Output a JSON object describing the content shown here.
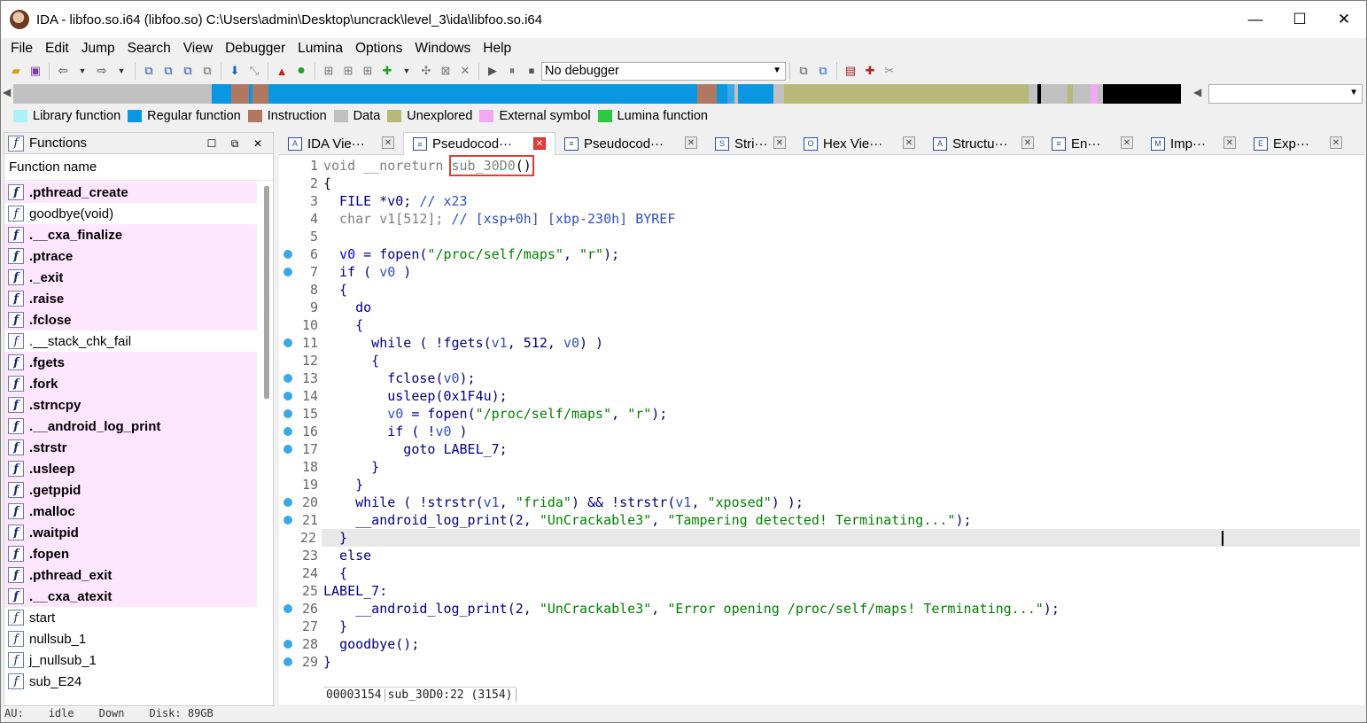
{
  "window": {
    "title": "IDA - libfoo.so.i64 (libfoo.so) C:\\Users\\admin\\Desktop\\uncrack\\level_3\\ida\\libfoo.so.i64",
    "minimize": "—",
    "maximize": "☐",
    "close": "✕"
  },
  "menu": [
    "File",
    "Edit",
    "Jump",
    "Search",
    "View",
    "Debugger",
    "Lumina",
    "Options",
    "Windows",
    "Help"
  ],
  "toolbar": {
    "debugger_value": "No debugger"
  },
  "legend": [
    {
      "label": "Library function",
      "color": "#aaf2f8"
    },
    {
      "label": "Regular function",
      "color": "#0a96e0"
    },
    {
      "label": "Instruction",
      "color": "#b07860"
    },
    {
      "label": "Data",
      "color": "#c0c0c0"
    },
    {
      "label": "Unexplored",
      "color": "#b8b878"
    },
    {
      "label": "External symbol",
      "color": "#f4a8f4"
    },
    {
      "label": "Lumina function",
      "color": "#30c840"
    }
  ],
  "functions_panel": {
    "title": "Functions",
    "column": "Function name",
    "items": [
      {
        "name": ".pthread_create",
        "lib": true
      },
      {
        "name": "goodbye(void)",
        "lib": false
      },
      {
        "name": ".__cxa_finalize",
        "lib": true
      },
      {
        "name": ".ptrace",
        "lib": true
      },
      {
        "name": "._exit",
        "lib": true
      },
      {
        "name": ".raise",
        "lib": true
      },
      {
        "name": ".fclose",
        "lib": true
      },
      {
        "name": ".__stack_chk_fail",
        "lib": false
      },
      {
        "name": ".fgets",
        "lib": true
      },
      {
        "name": ".fork",
        "lib": true
      },
      {
        "name": ".strncpy",
        "lib": true
      },
      {
        "name": ".__android_log_print",
        "lib": true
      },
      {
        "name": ".strstr",
        "lib": true
      },
      {
        "name": ".usleep",
        "lib": true
      },
      {
        "name": ".getppid",
        "lib": true
      },
      {
        "name": ".malloc",
        "lib": true
      },
      {
        "name": ".waitpid",
        "lib": true
      },
      {
        "name": ".fopen",
        "lib": true
      },
      {
        "name": ".pthread_exit",
        "lib": true
      },
      {
        "name": ".__cxa_atexit",
        "lib": true
      },
      {
        "name": "start",
        "lib": false
      },
      {
        "name": "nullsub_1",
        "lib": false
      },
      {
        "name": "j_nullsub_1",
        "lib": false
      },
      {
        "name": "sub_E24",
        "lib": false
      }
    ]
  },
  "tabs": [
    {
      "label": "IDA Vie···",
      "icon": "A",
      "active": false
    },
    {
      "label": "Pseudocod···",
      "icon": "≡",
      "active": true
    },
    {
      "label": "Pseudocod···",
      "icon": "≡",
      "active": false
    },
    {
      "label": "Stri···",
      "icon": "S",
      "active": false
    },
    {
      "label": "Hex Vie···",
      "icon": "O",
      "active": false
    },
    {
      "label": "Structu···",
      "icon": "A",
      "active": false
    },
    {
      "label": "En···",
      "icon": "≡",
      "active": false
    },
    {
      "label": "Imp···",
      "icon": "M",
      "active": false
    },
    {
      "label": "Exp···",
      "icon": "E",
      "active": false
    }
  ],
  "code": {
    "lines": [
      {
        "n": "1",
        "bp": false
      },
      {
        "n": "2",
        "bp": false
      },
      {
        "n": "3",
        "bp": false
      },
      {
        "n": "4",
        "bp": false
      },
      {
        "n": "5",
        "bp": false
      },
      {
        "n": "6",
        "bp": true
      },
      {
        "n": "7",
        "bp": true
      },
      {
        "n": "8",
        "bp": false
      },
      {
        "n": "9",
        "bp": false
      },
      {
        "n": "10",
        "bp": false
      },
      {
        "n": "11",
        "bp": true
      },
      {
        "n": "12",
        "bp": false
      },
      {
        "n": "13",
        "bp": true
      },
      {
        "n": "14",
        "bp": true
      },
      {
        "n": "15",
        "bp": true
      },
      {
        "n": "16",
        "bp": true
      },
      {
        "n": "17",
        "bp": true
      },
      {
        "n": "18",
        "bp": false
      },
      {
        "n": "19",
        "bp": false
      },
      {
        "n": "20",
        "bp": true
      },
      {
        "n": "21",
        "bp": true
      },
      {
        "n": "22",
        "bp": false
      },
      {
        "n": "23",
        "bp": false
      },
      {
        "n": "24",
        "bp": false
      },
      {
        "n": "25",
        "bp": false
      },
      {
        "n": "26",
        "bp": true
      },
      {
        "n": "27",
        "bp": false
      },
      {
        "n": "28",
        "bp": true
      },
      {
        "n": "29",
        "bp": true
      }
    ],
    "t": {
      "l1a": "void __noreturn ",
      "l1b": "sub_30D0",
      "l1c": "()",
      "l2": "{",
      "l3a": "  FILE *v0; ",
      "l3b": "// x23",
      "l4a": "  char v1[512]; ",
      "l4b": "// [xsp+0h] [xbp-230h] BYREF",
      "l6a": "  ",
      "l6b": "v0",
      "l6c": " = ",
      "l6d": "fopen",
      "l6e": "(",
      "l6f": "\"/proc/self/maps\"",
      "l6g": ", ",
      "l6h": "\"r\"",
      "l6i": ");",
      "l7a": "  if ( ",
      "l7b": "v0",
      "l7c": " )",
      "l8": "  {",
      "l9": "    do",
      "l10": "    {",
      "l11a": "      while ( !",
      "l11b": "fgets",
      "l11c": "(",
      "l11d": "v1",
      "l11e": ", 512, ",
      "l11f": "v0",
      "l11g": ") )",
      "l12": "      {",
      "l13a": "        ",
      "l13b": "fclose",
      "l13c": "(",
      "l13d": "v0",
      "l13e": ");",
      "l14a": "        ",
      "l14b": "usleep",
      "l14c": "(0x1F4u);",
      "l15a": "        ",
      "l15b": "v0",
      "l15c": " = ",
      "l15d": "fopen",
      "l15e": "(",
      "l15f": "\"/proc/self/maps\"",
      "l15g": ", ",
      "l15h": "\"r\"",
      "l15i": ");",
      "l16a": "        if ( !",
      "l16b": "v0",
      "l16c": " )",
      "l17": "          goto LABEL_7;",
      "l18": "      }",
      "l19": "    }",
      "l20a": "    while ( !",
      "l20b": "strstr",
      "l20c": "(",
      "l20d": "v1",
      "l20e": ", ",
      "l20f": "\"frida\"",
      "l20g": ") && !",
      "l20h": "strstr",
      "l20i": "(",
      "l20j": "v1",
      "l20k": ", ",
      "l20l": "\"xposed\"",
      "l20m": ") );",
      "l21a": "    ",
      "l21b": "__android_log_print",
      "l21c": "(2, ",
      "l21d": "\"UnCrackable3\"",
      "l21e": ", ",
      "l21f": "\"Tampering detected! Terminating...\"",
      "l21g": ");",
      "l22": "  }",
      "l23": "  else",
      "l24": "  {",
      "l25": "LABEL_7:",
      "l26a": "    ",
      "l26b": "__android_log_print",
      "l26c": "(2, ",
      "l26d": "\"UnCrackable3\"",
      "l26e": ", ",
      "l26f": "\"Error opening /proc/self/maps! Terminating...\"",
      "l26g": ");",
      "l27": "  }",
      "l28a": "  ",
      "l28b": "goodbye",
      "l28c": "();",
      "l29": "}"
    },
    "status_addr": "00003154",
    "status_loc": "sub_30D0:22 (3154)"
  },
  "statusbar": {
    "au": "AU:",
    "state": "idle",
    "dir": "Down",
    "disk": "Disk: 89GB"
  }
}
